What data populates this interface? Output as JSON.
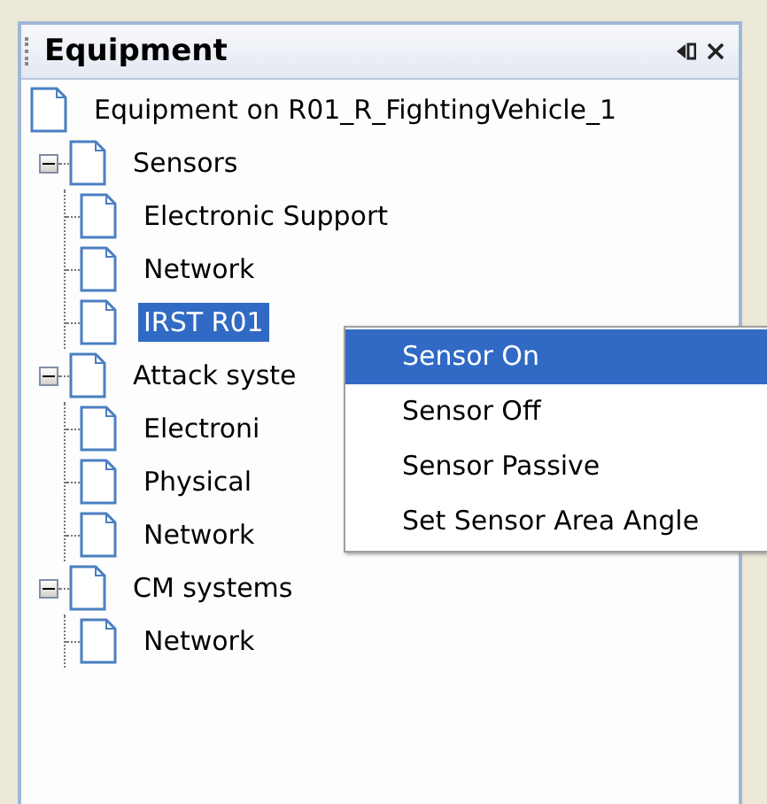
{
  "panel": {
    "title": "Equipment"
  },
  "tree": [
    {
      "label": "Equipment on R01_R_FightingVehicle_1",
      "selected": false
    },
    {
      "label": "Sensors",
      "expanded": true,
      "selected": false,
      "children": [
        {
          "label": "Electronic Support",
          "selected": false
        },
        {
          "label": "Network",
          "selected": false
        },
        {
          "label": "IRST R01",
          "selected": true
        }
      ]
    },
    {
      "label": "Attack syste",
      "expanded": true,
      "selected": false,
      "children": [
        {
          "label": "Electroni",
          "selected": false
        },
        {
          "label": "Physical",
          "selected": false
        },
        {
          "label": "Network",
          "selected": false
        }
      ]
    },
    {
      "label": "CM systems",
      "expanded": true,
      "selected": false,
      "children": [
        {
          "label": "Network",
          "selected": false
        }
      ]
    }
  ],
  "context_menu": [
    {
      "label": "Sensor On",
      "selected": true
    },
    {
      "label": "Sensor Off",
      "selected": false
    },
    {
      "label": "Sensor Passive",
      "selected": false
    },
    {
      "label": "Set Sensor Area Angle",
      "selected": false
    }
  ]
}
